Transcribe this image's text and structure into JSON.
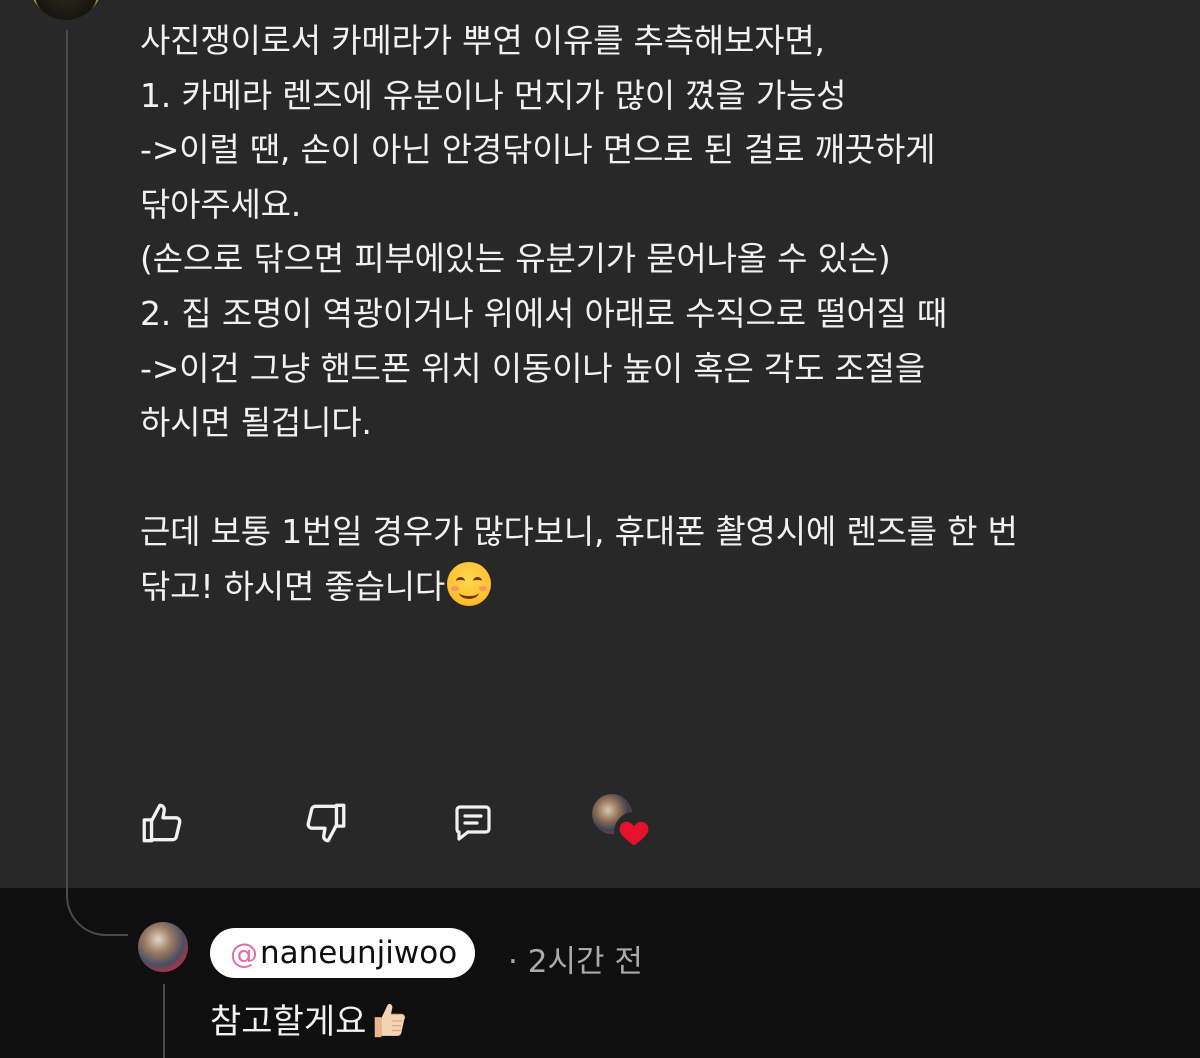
{
  "comment": {
    "lines": [
      "사진쟁이로서 카메라가 뿌연 이유를 추측해보자면,",
      "1. 카메라 렌즈에 유분이나 먼지가 많이 꼈을 가능성",
      "->이럴 땐, 손이 아닌 안경닦이나 면으로 된 걸로 깨끗하게",
      "닦아주세요.",
      "(손으로 닦으면 피부에있는 유분기가 묻어나올 수 있슨)",
      "2. 집 조명이 역광이거나 위에서 아래로 수직으로 떨어질 때",
      "->이건 그냥 핸드폰 위치 이동이나 높이 혹은 각도 조절을",
      "하시면 될겁니다.",
      "",
      "근데 보통 1번일 경우가 많다보니, 휴대폰 촬영시에 렌즈를 한 번",
      "닦고! 하시면 좋습니다"
    ],
    "trailing_emoji": "smiling-face-icon"
  },
  "actions": {
    "like_icon": "thumbs-up-icon",
    "dislike_icon": "thumbs-down-icon",
    "reply_icon": "reply-icon",
    "creator_heart_icon": "heart-icon"
  },
  "reply": {
    "handle": "naneunjiwoo",
    "at_symbol": "@",
    "separator": "·",
    "time": "2시간 전",
    "text": "참고할게요",
    "trailing_emoji": "thumbs-up-emoji-icon"
  },
  "colors": {
    "panel_bg": "#282828",
    "page_bg": "#0f0f0f",
    "text": "#f1f1f1",
    "muted": "#aaaaaa",
    "heart": "#e8112d",
    "handle_pill_bg": "#ffffff"
  }
}
